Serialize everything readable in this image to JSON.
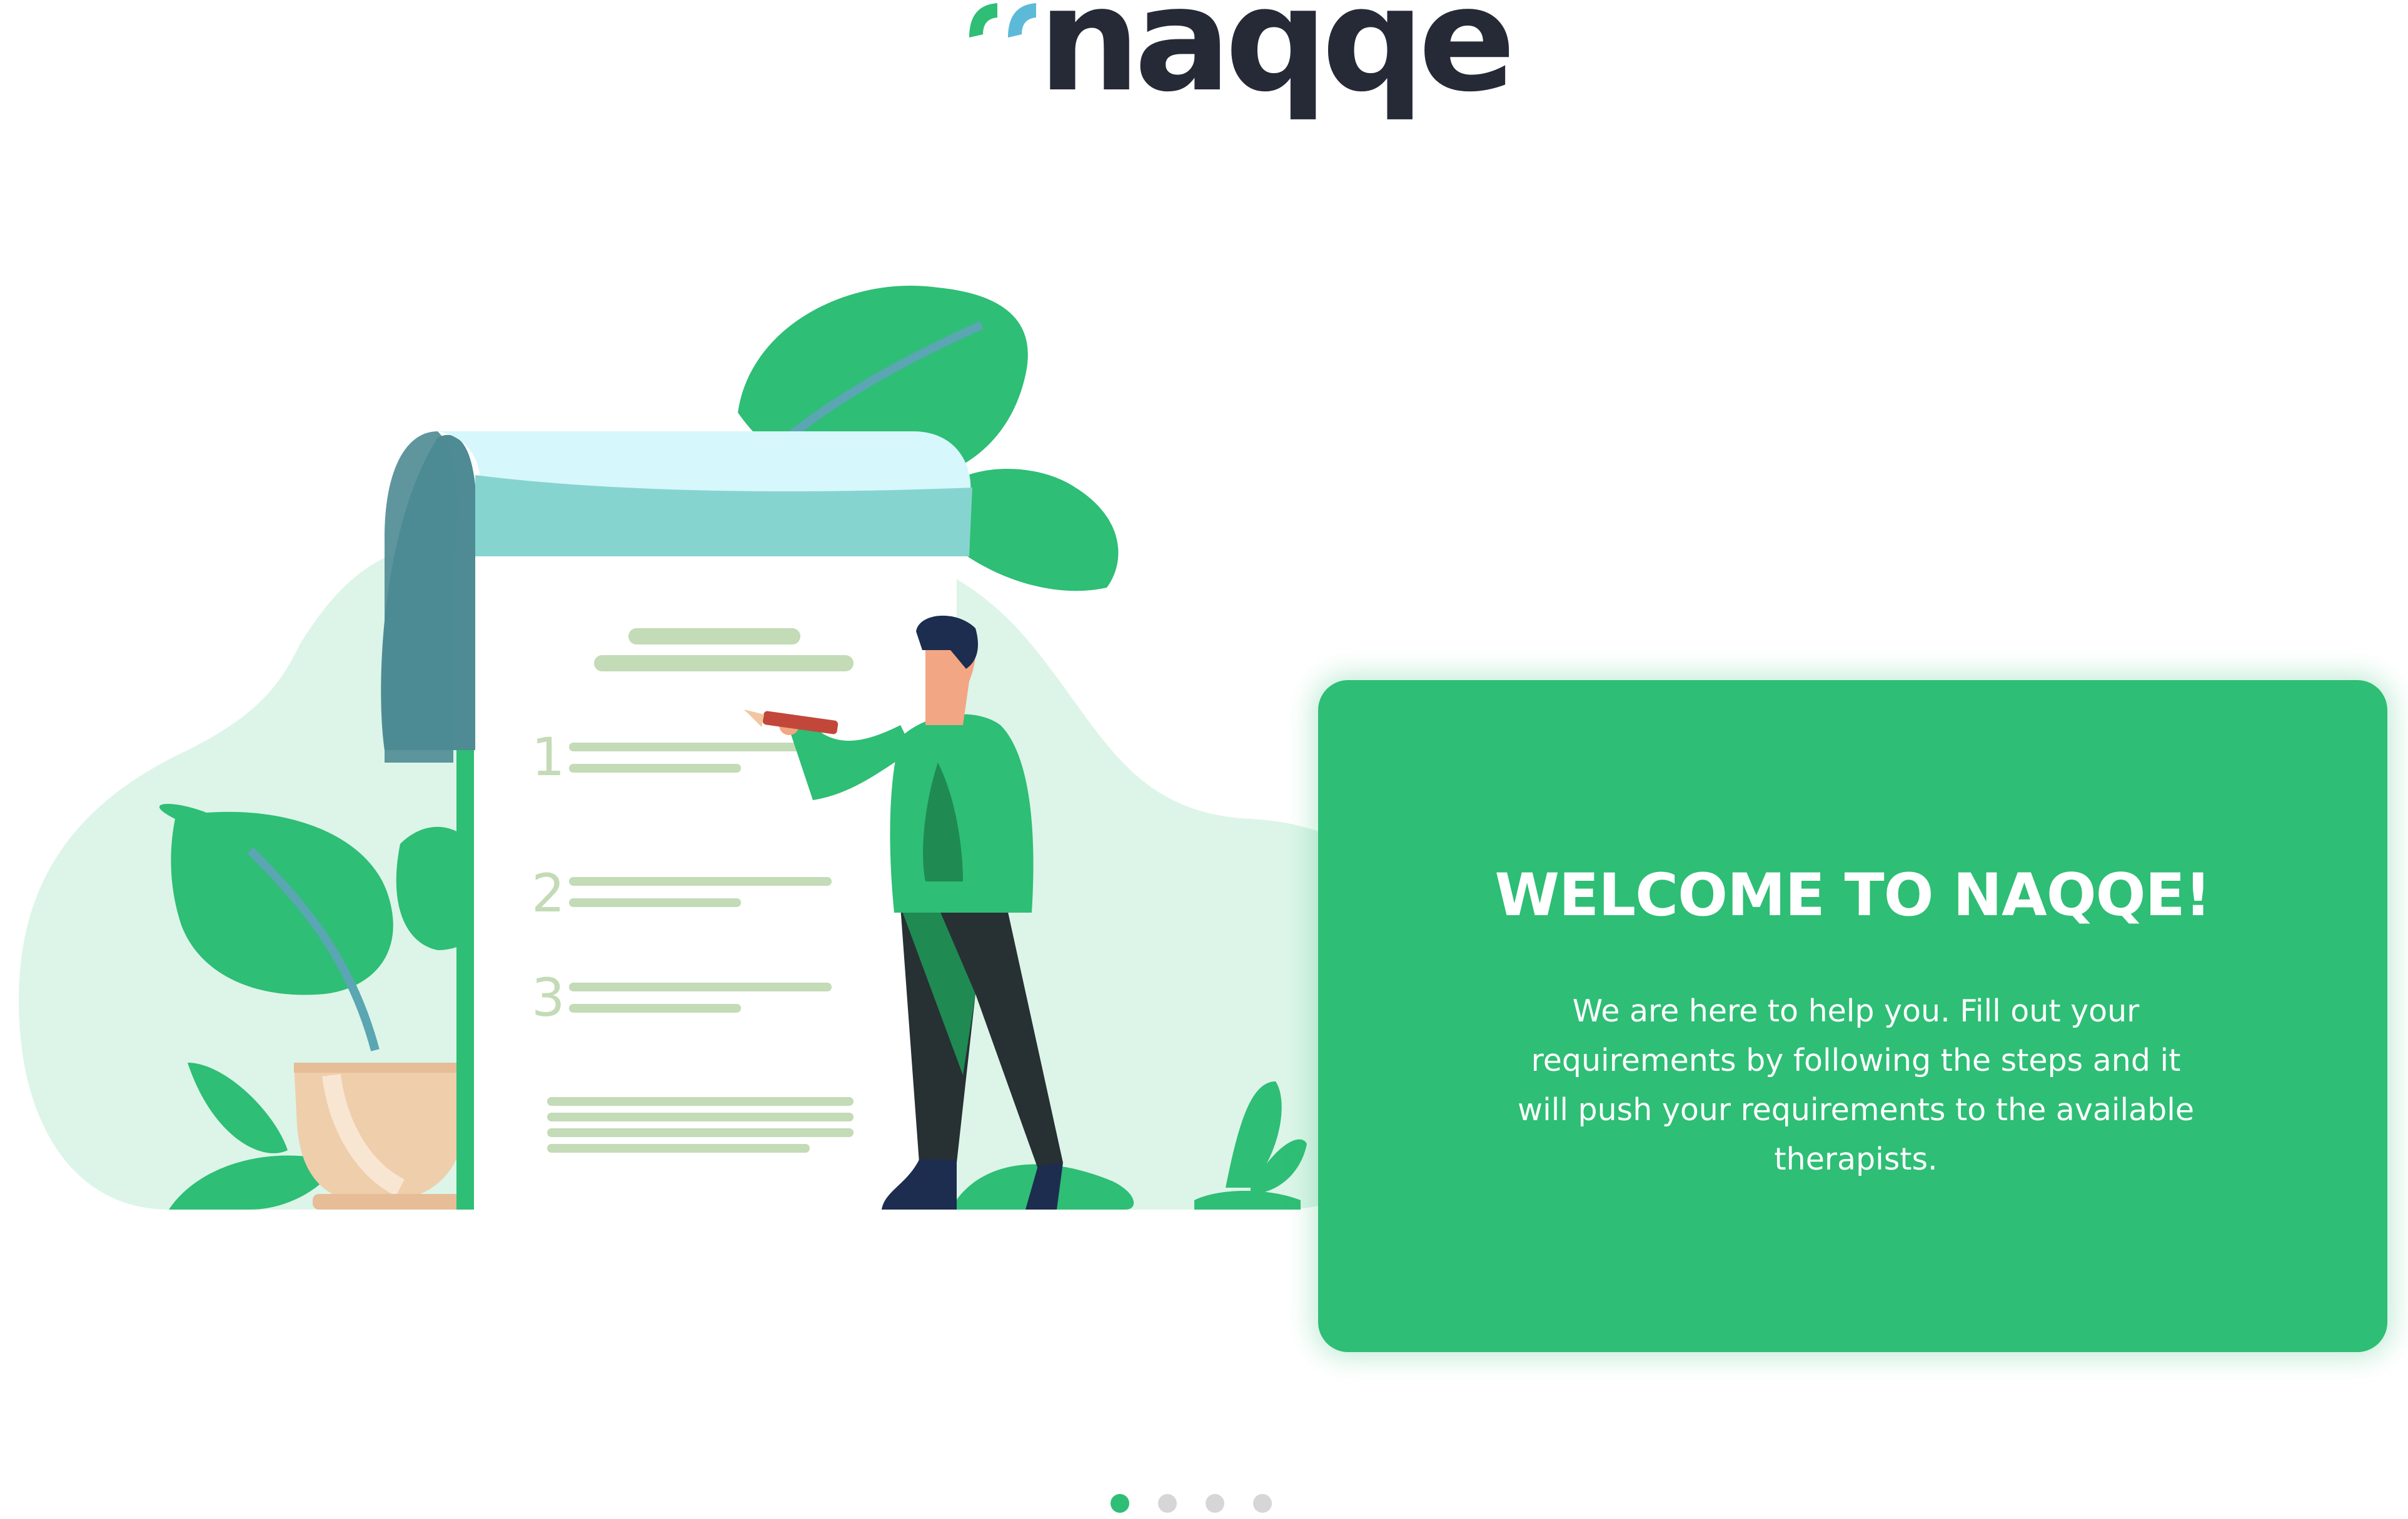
{
  "brand": {
    "name": "naqqe",
    "primary_color": "#2ebe75",
    "dark_color": "#262a37",
    "accent_color": "#5cbad8"
  },
  "welcome_card": {
    "title": "WELCOME TO NAQQE!",
    "body": "We are here to help you. Fill out your requirements by following the steps and it will push your requirements to the available therapists."
  },
  "illustration": {
    "icon": "checklist-illustration",
    "steps": [
      "1",
      "2",
      "3"
    ]
  },
  "carousel": {
    "total_slides": 4,
    "active_slide": 1,
    "active_color": "#2ebe75",
    "inactive_color": "#d6d6d6"
  }
}
